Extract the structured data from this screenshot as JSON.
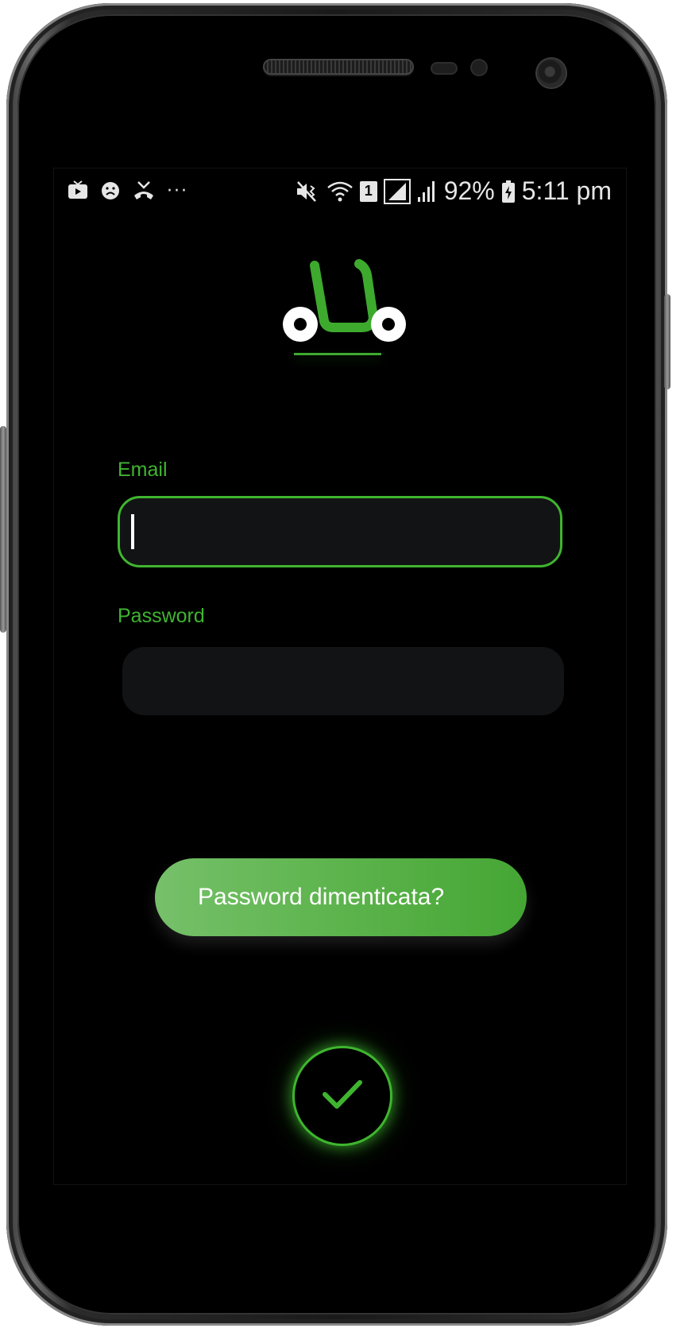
{
  "status_bar": {
    "battery": "92%",
    "time": "5:11 pm",
    "sim_slot": "1",
    "more": "···"
  },
  "login": {
    "email_label": "Email",
    "email_value": "",
    "password_label": "Password",
    "password_value": "",
    "forgot_password": "Password dimenticata?"
  },
  "colors": {
    "accent": "#3fb52f",
    "button": "#5fb54f",
    "field_bg": "#121315",
    "background": "#000000"
  }
}
